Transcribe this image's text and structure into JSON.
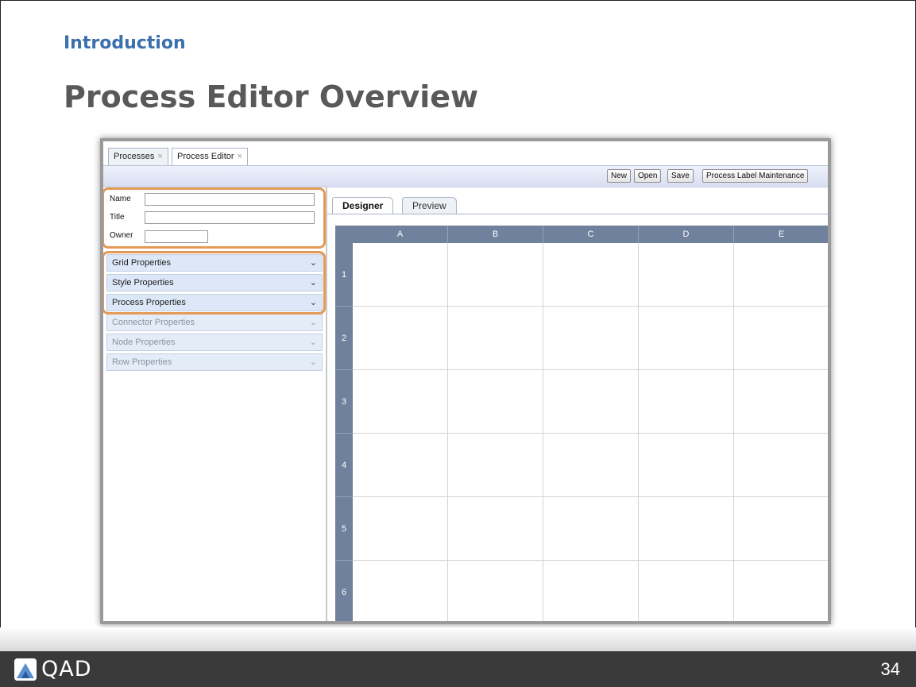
{
  "slide": {
    "section": "Introduction",
    "title": "Process Editor Overview",
    "page_number": "34",
    "brand": "QAD"
  },
  "app": {
    "tabs": [
      {
        "label": "Processes",
        "close": "×"
      },
      {
        "label": "Process Editor",
        "close": "×"
      }
    ],
    "toolbar": {
      "new_label": "New",
      "open_label": "Open",
      "save_label": "Save",
      "label_maint_label": "Process Label Maintenance"
    },
    "form": {
      "name_label": "Name",
      "title_label": "Title",
      "owner_label": "Owner",
      "name_value": "",
      "title_value": "",
      "owner_value": ""
    },
    "accordion": [
      {
        "label": "Grid Properties",
        "enabled": true
      },
      {
        "label": "Style Properties",
        "enabled": true
      },
      {
        "label": "Process Properties",
        "enabled": true
      },
      {
        "label": "Connector Properties",
        "enabled": false
      },
      {
        "label": "Node Properties",
        "enabled": false
      },
      {
        "label": "Row Properties",
        "enabled": false
      }
    ],
    "designer": {
      "tabs": [
        {
          "label": "Designer",
          "active": true
        },
        {
          "label": "Preview",
          "active": false
        }
      ],
      "columns": [
        "A",
        "B",
        "C",
        "D",
        "E"
      ],
      "rows": [
        "1",
        "2",
        "3",
        "4",
        "5",
        "6"
      ]
    }
  },
  "colors": {
    "section_title": "#3b6fae",
    "slide_title": "#595959",
    "highlight_outline": "#e49a55",
    "grid_header": "#6f819c",
    "accordion_bg": "#dce8f7",
    "footer_bg": "#3a3a3a"
  },
  "icons": {
    "accordion_chevron": "chevron-down-icon",
    "tab_close": "close-icon",
    "logo": "qad-logo-icon"
  }
}
